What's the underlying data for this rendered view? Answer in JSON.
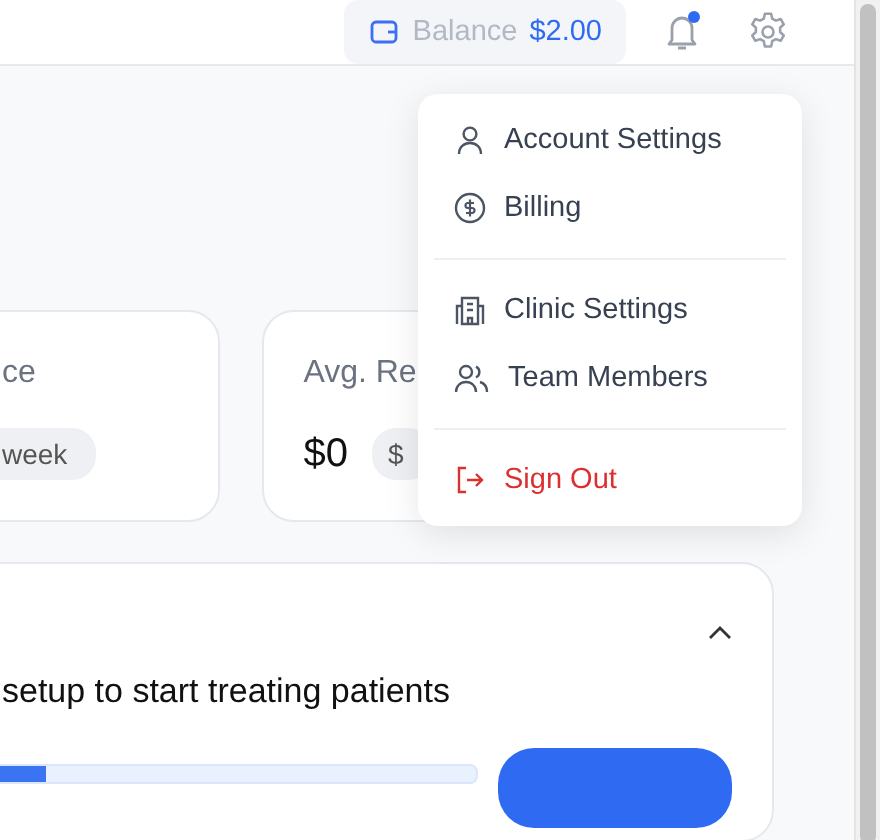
{
  "header": {
    "balance": {
      "label": "Balance",
      "amount": "$2.00"
    },
    "notifications": {
      "unread": true
    }
  },
  "cards": [
    {
      "title": "ce",
      "badge": "week"
    },
    {
      "title": "Avg. Re",
      "value": "$0",
      "badge": "$"
    }
  ],
  "setup": {
    "text": "setup to start treating patients",
    "expanded": true,
    "progress": {
      "level": 0.22
    }
  },
  "menu": {
    "groups": [
      [
        {
          "label": "Account Settings",
          "kind": "account"
        },
        {
          "label": "Billing",
          "kind": "billing"
        }
      ],
      [
        {
          "label": "Clinic Settings",
          "kind": "clinic"
        },
        {
          "label": "Team Members",
          "kind": "team"
        }
      ],
      [
        {
          "label": "Sign Out",
          "kind": "signout"
        }
      ]
    ]
  }
}
